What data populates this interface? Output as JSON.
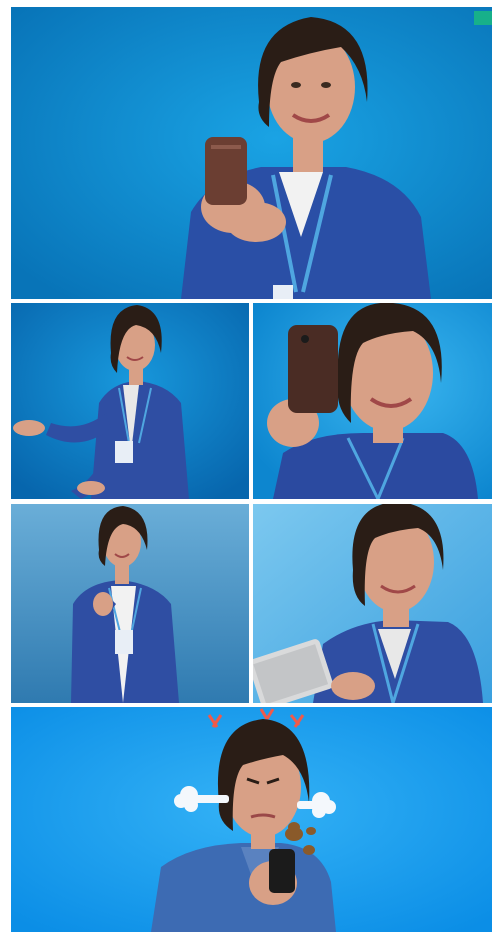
{
  "panels": [
    {
      "id": "p1",
      "bg": "#0a8fd2",
      "jacket": "#2a4fa6"
    },
    {
      "id": "p2",
      "bg": "#0a7fc8",
      "jacket": "#2f4ea3"
    },
    {
      "id": "p3",
      "bg": "#1a9ee0",
      "jacket": "#2b4aa0"
    },
    {
      "id": "p4",
      "bg": "#4b98cc",
      "jacket": "#2f4ea3"
    },
    {
      "id": "p5",
      "bg": "#56b3e6",
      "jacket": "#2f4ea3"
    },
    {
      "id": "p6",
      "bg": "#129df0",
      "jacket": "#3d6bb3"
    }
  ],
  "colors": {
    "hair": "#2a1d16",
    "skin": "#d8a086",
    "phone": "#6b3e32",
    "badge": "#17b08a",
    "lanyard": "#4fa6e0",
    "top_white": "#f2f2f2"
  },
  "icons": [
    "phone-icon",
    "tablet-icon",
    "anger-mark-icon",
    "steam-puff-icon",
    "poop-emoji-icon"
  ]
}
